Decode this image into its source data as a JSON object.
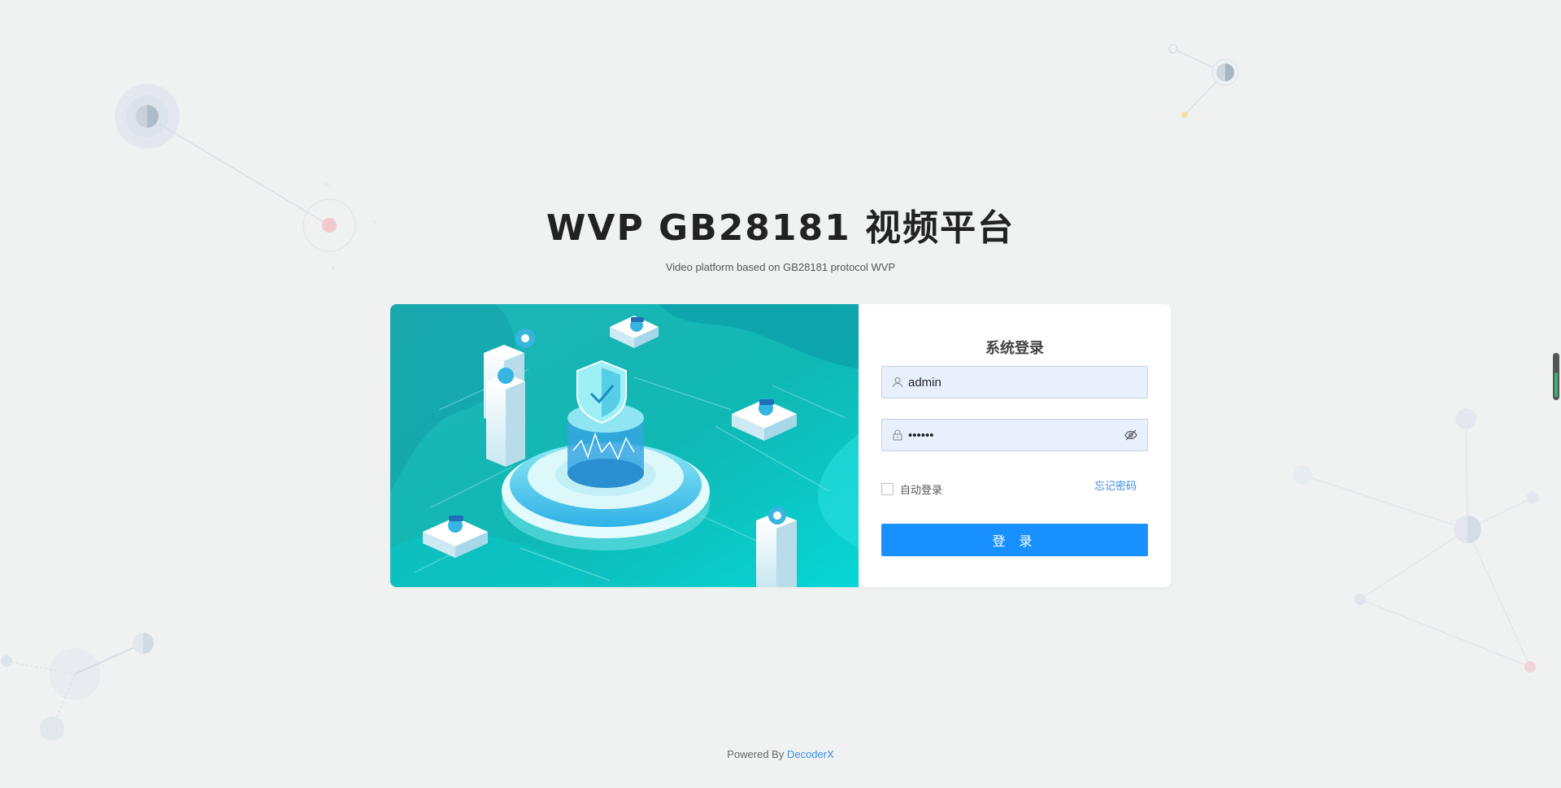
{
  "header": {
    "title": "WVP GB28181 视频平台",
    "subtitle": "Video platform based on GB28181 protocol WVP"
  },
  "login": {
    "title": "系统登录",
    "username_value": "admin",
    "password_value": "••••••",
    "remember_label": "自动登录",
    "forgot_label": "忘记密码",
    "submit_label": "登 录"
  },
  "footer": {
    "powered_by": "Powered By",
    "brand": "DecoderX"
  },
  "colors": {
    "primary": "#1890ff",
    "link": "#3a8ee6",
    "input_bg": "#e8f0fe",
    "illustration_teal": "#16c8c0"
  },
  "icons": [
    "user-icon",
    "lock-icon",
    "eye-off-icon",
    "shield-icon",
    "location-pin-icon",
    "camera-icon"
  ]
}
